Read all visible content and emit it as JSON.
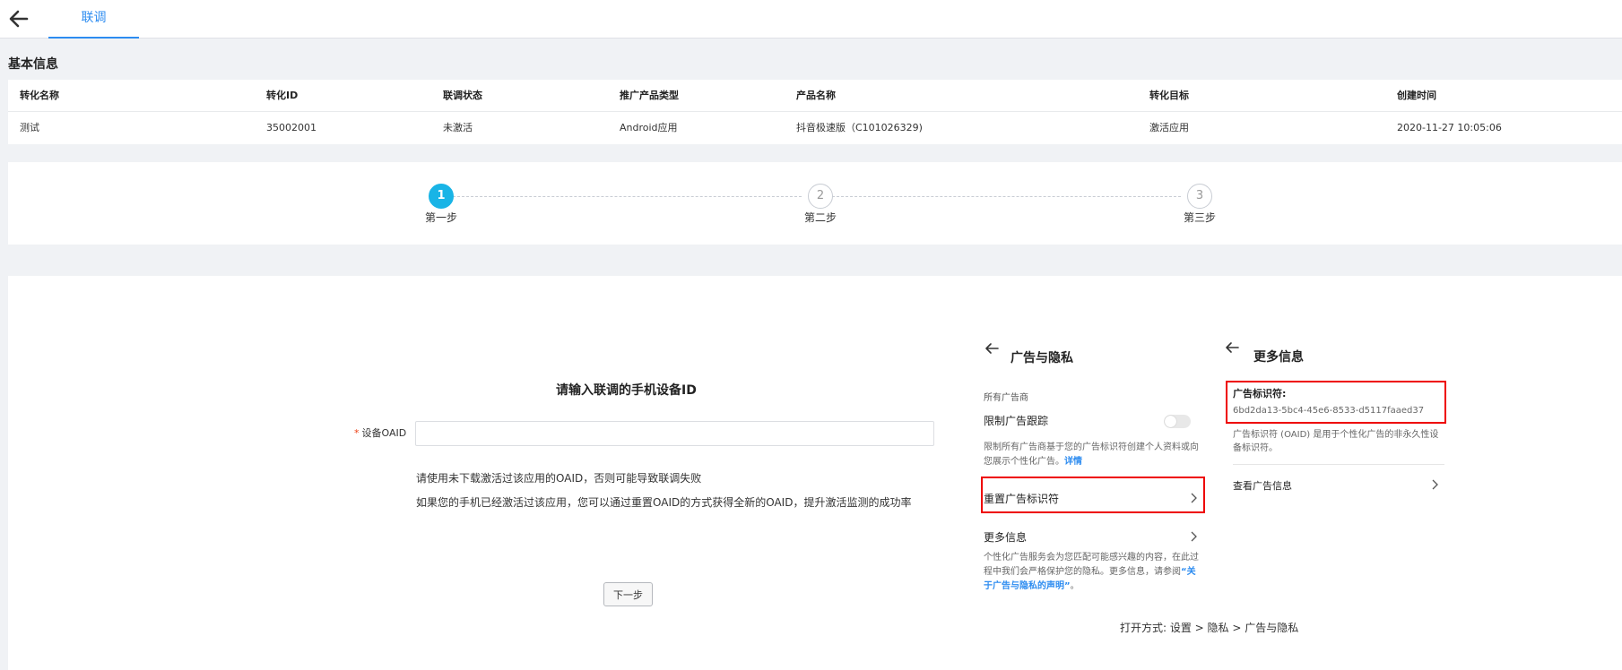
{
  "header": {
    "back_icon": "arrow-left-icon",
    "tab_label": "联调"
  },
  "basic_info": {
    "title": "基本信息",
    "columns": [
      "转化名称",
      "转化ID",
      "联调状态",
      "推广产品类型",
      "产品名称",
      "转化目标",
      "创建时间"
    ],
    "row": [
      "测试",
      "35002001",
      "未激活",
      "Android应用",
      "抖音极速版（C101026329)",
      "激活应用",
      "2020-11-27 10:05:06"
    ]
  },
  "steps": {
    "current": 1,
    "items": [
      {
        "number": "1",
        "label": "第一步"
      },
      {
        "number": "2",
        "label": "第二步"
      },
      {
        "number": "3",
        "label": "第三步"
      }
    ]
  },
  "form": {
    "title": "请输入联调的手机设备ID",
    "required_mark": "*",
    "oaid_label": "设备OAID",
    "oaid_value": "",
    "oaid_placeholder": "",
    "tips": [
      "请使用未下载激活过该应用的OAID，否则可能导致联调失败",
      "如果您的手机已经激活过该应用，您可以通过重置OAID的方式获得全新的OAID，提升激活监测的成功率"
    ],
    "next_button": "下一步"
  },
  "guide_ad_privacy": {
    "back_icon": "arrow-left-icon",
    "title": "广告与隐私",
    "all_advertisers": "所有广告商",
    "limit_tracking_label": "限制广告跟踪",
    "limit_tracking_on": false,
    "limit_tracking_desc": "限制所有广告商基于您的广告标识符创建个人资料或向您展示个性化广告。",
    "details_link": "详情",
    "reset_label": "重置广告标识符",
    "more_info_label": "更多信息",
    "more_info_desc_prefix": "个性化广告服务会为您匹配可能感兴趣的内容，在此过程中我们会严格保护您的隐私。更多信息，请参阅",
    "more_info_link": "“关于广告与隐私的声明”",
    "more_info_desc_suffix": "。",
    "open_way": "打开方式: 设置 > 隐私 > 广告与隐私",
    "highlight_color": "#e00000"
  },
  "guide_more_info": {
    "back_icon": "arrow-left-icon",
    "title": "更多信息",
    "ad_id_label": "广告标识符:",
    "ad_id_value": "6bd2da13-5bc4-45e6-8533-d5117faaed37",
    "ad_id_desc": "广告标识符 (OAID) 是用于个性化广告的非永久性设备标识符。",
    "view_ad_info": "查看广告信息",
    "chevron_icon": "chevron-right-icon"
  }
}
